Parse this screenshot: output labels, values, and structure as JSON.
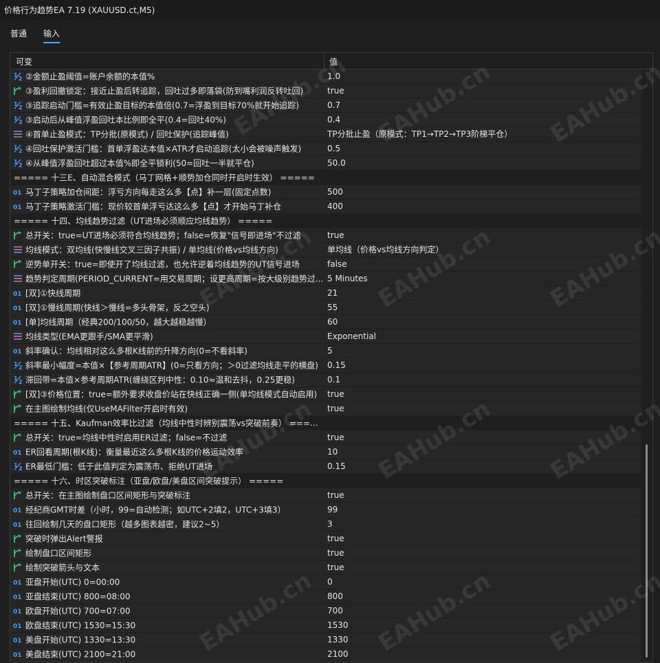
{
  "window": {
    "title": "价格行为趋势EA 7.19 (XAUUSD.ct,M5)"
  },
  "tabs": [
    {
      "label": "普通"
    },
    {
      "label": "输入"
    }
  ],
  "table": {
    "col_variable": "可变",
    "col_value": "值"
  },
  "watermark": "EAHub.cn",
  "rows": [
    {
      "type": "half",
      "name": "②金额止盈阈值=账户余额的本值%",
      "value": "1.0"
    },
    {
      "type": "bool",
      "name": "③盈利回撤锁定：接近止盈后转追踪，回吐过多即落袋(防到嘴利润反转吐回)",
      "value": "true"
    },
    {
      "type": "half",
      "name": "③追踪启动门槛=有效止盈目标的本值倍(0.7=浮盈到目标70%就开始追踪)",
      "value": "0.7"
    },
    {
      "type": "half",
      "name": "③启动后从峰值浮盈回吐本比例即全平(0.4=回吐40%)",
      "value": "0.4"
    },
    {
      "type": "enum",
      "name": "④首单止盈模式：TP分批(原模式) / 回吐保护(追踪峰值)",
      "value": "TP分批止盈（原模式：TP1→TP2→TP3阶梯平仓）"
    },
    {
      "type": "half",
      "name": "④回吐保护激活门槛：首单浮盈达本值×ATR才启动追踪(太小会被噪声触发)",
      "value": "0.5"
    },
    {
      "type": "half",
      "name": "④从峰值浮盈回吐超过本值%即全平锁利(50=回吐一半就平仓)",
      "value": "50.0"
    },
    {
      "type": "section",
      "name": "===== 十三E、自动混合模式（马丁网格+顺势加仓同时开启时生效） =====",
      "value": ""
    },
    {
      "type": "int",
      "name": "马丁子策略加仓间距：浮亏方向每走这么多【点】补一层(固定点数)",
      "value": "500"
    },
    {
      "type": "int",
      "name": "马丁子策略激活门槛：现价较首单浮亏达这么多【点】才开始马丁补仓",
      "value": "400"
    },
    {
      "type": "section",
      "name": "===== 十四、均线趋势过滤（UT进场必须顺应均线趋势） =====",
      "value": ""
    },
    {
      "type": "bool",
      "name": "总开关：true=UT进场必须符合均线趋势；false=恢复\"信号即进场\"不过滤",
      "value": "true"
    },
    {
      "type": "enum",
      "name": "均线模式：双均线(快慢线交叉三因子共振) / 单均线(价格vs均线方向)",
      "value": "单均线（价格vs均线方向判定）"
    },
    {
      "type": "bool",
      "name": "逆势单开关：true=即使开了均线过滤，也允许逆着均线趋势的UT信号进场",
      "value": "false"
    },
    {
      "type": "enum",
      "name": "趋势判定周期(PERIOD_CURRENT=用交易周期；设更高周期=按大级别趋势过...",
      "value": "5 Minutes"
    },
    {
      "type": "int",
      "name": "[双]①快线周期",
      "value": "21"
    },
    {
      "type": "int",
      "name": "[双]①慢线周期(快线＞慢线=多头骨架，反之空头)",
      "value": "55"
    },
    {
      "type": "int",
      "name": "[单]均线周期（经典200/100/50，越大越稳越慢）",
      "value": "60"
    },
    {
      "type": "enum",
      "name": "均线类型(EMA更跟手/SMA更平滑)",
      "value": "Exponential"
    },
    {
      "type": "int",
      "name": "斜率确认：均线相对这么多根K线前的升降方向(0=不看斜率)",
      "value": "5"
    },
    {
      "type": "half",
      "name": "斜率最小幅度=本值×【参考周期ATR】(0=只看方向；＞0过滤均线走平的横盘)",
      "value": "0.15"
    },
    {
      "type": "half",
      "name": "滞回带=本值×参考周期ATR(缠绕区判中性：0.10≈温和去抖，0.25更稳)",
      "value": "0.1"
    },
    {
      "type": "bool",
      "name": "[双]③价格位置：true=额外要求收盘价站在快线正确一侧(单均线模式自动启用)",
      "value": "true"
    },
    {
      "type": "bool",
      "name": "在主图绘制均线(仅UseMAFilter开启时有效)",
      "value": "true"
    },
    {
      "type": "section",
      "name": "===== 十五、Kaufman效率比过滤（均线中性时辨别震荡vs突破前奏） =====",
      "value": ""
    },
    {
      "type": "bool",
      "name": "总开关：true=均线中性时启用ER过滤；false=不过滤",
      "value": "true"
    },
    {
      "type": "int",
      "name": "ER回看周期(根K线)：衡量最近这么多根K线的价格运动效率",
      "value": "10"
    },
    {
      "type": "half",
      "name": "ER最低门槛：低于此值判定为震荡市、拒绝UT进场",
      "value": "0.15"
    },
    {
      "type": "section",
      "name": "===== 十六、时区突破标注（亚盘/欧盘/美盘区间突破提示） =====",
      "value": ""
    },
    {
      "type": "bool",
      "name": "总开关：在主图绘制盘口区间矩形与突破标注",
      "value": "true"
    },
    {
      "type": "int",
      "name": "经纪商GMT时差（小时，99=自动检测；如UTC+2填2，UTC+3填3）",
      "value": "99"
    },
    {
      "type": "int",
      "name": "往回绘制几天的盘口矩形（越多图表越密，建议2~5）",
      "value": "3"
    },
    {
      "type": "bool",
      "name": "突破时弹出Alert警报",
      "value": "true"
    },
    {
      "type": "bool",
      "name": "绘制盘口区间矩形",
      "value": "true"
    },
    {
      "type": "bool",
      "name": "绘制突破箭头与文本",
      "value": "true"
    },
    {
      "type": "int",
      "name": "亚盘开始(UTC) 0=00:00",
      "value": "0"
    },
    {
      "type": "int",
      "name": "亚盘结束(UTC) 800=08:00",
      "value": "800"
    },
    {
      "type": "int",
      "name": "欧盘开始(UTC) 700=07:00",
      "value": "700"
    },
    {
      "type": "int",
      "name": "欧盘结束(UTC) 1530=15:30",
      "value": "1530"
    },
    {
      "type": "int",
      "name": "美盘开始(UTC) 1330=13:30",
      "value": "1330"
    },
    {
      "type": "int",
      "name": "美盘结束(UTC) 2100=21:00",
      "value": "2100"
    }
  ],
  "colors": {
    "int_icon": "#4a9eff",
    "half_icon": "#4a9eff",
    "bool_icon": "#3fbf6a",
    "enum_icon_a": "#e05a5a",
    "enum_icon_b": "#4a7fd9"
  }
}
